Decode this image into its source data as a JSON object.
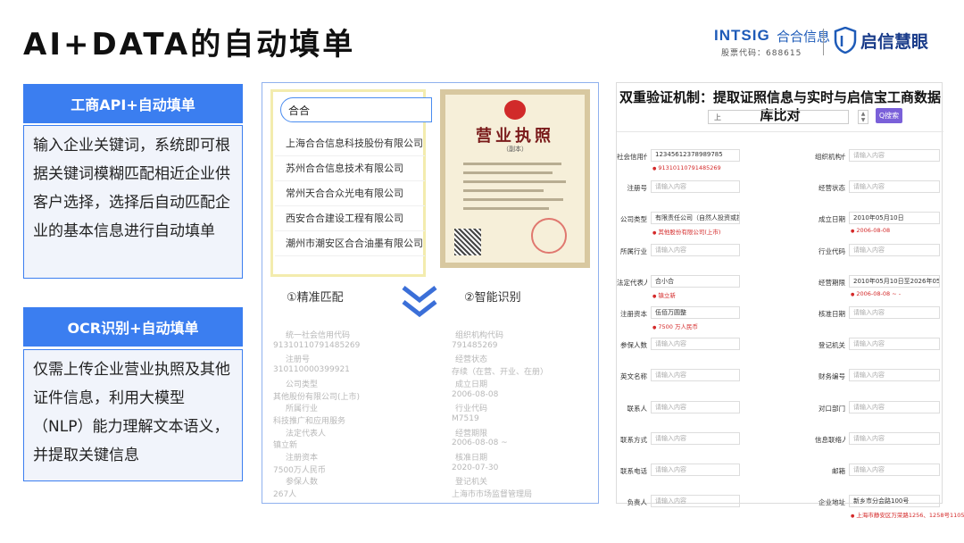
{
  "title": "AI+DATA的自动填单",
  "logo": {
    "intsig": "INTSIG",
    "intsig_cn": "合合信息",
    "stock_code": "股票代码：688615",
    "qixin": "启信慧眼",
    "qixin_icon": "qixin-shield-icon"
  },
  "section_api": {
    "header": "工商API+自动填单",
    "body": "输入企业关键词，系统即可根据关键词模糊匹配相近企业供客户选择，选择后自动匹配企业的基本信息进行自动填单"
  },
  "section_ocr": {
    "header": "OCR识别+自动填单",
    "body": "仅需上传企业营业执照及其他证件信息，利用大模型（NLP）能力理解文本语义，并提取关键信息"
  },
  "search": {
    "value": "合合",
    "suggestions": [
      "上海合合信息科技股份有限公司",
      "苏州合合信息技术有限公司",
      "常州天合合众光电有限公司",
      "西安合合建设工程有限公司",
      "潮州市潮安区合合油墨有限公司"
    ]
  },
  "license": {
    "title": "营业执照",
    "subtitle": "（副本）"
  },
  "steps": {
    "step1": "①精准匹配",
    "step2": "②智能识别"
  },
  "faded_form": [
    [
      "统一社会信用代码",
      "组织机构代码"
    ],
    [
      "91310110791485269",
      "791485269"
    ],
    [
      "注册号",
      "经营状态"
    ],
    [
      "310110000399921",
      "存续（在营、开业、在册）"
    ],
    [
      "公司类型",
      "成立日期"
    ],
    [
      "其他股份有限公司(上市)",
      "2006-08-08"
    ],
    [
      "所属行业",
      "行业代码"
    ],
    [
      "科技推广和应用服务",
      "M7519"
    ],
    [
      "法定代表人",
      "经营期限"
    ],
    [
      "镇立新",
      "2006-08-08 ~"
    ],
    [
      "注册资本",
      "核准日期"
    ],
    [
      "7500万人民币",
      "2020-07-30"
    ],
    [
      "参保人数",
      "登记机关"
    ],
    [
      "267人",
      "上海市市场监督管理局"
    ]
  ],
  "right_panel": {
    "title": "双重验证机制：提取证照信息与实时与启信宝工商数据库比对",
    "search_value": "上",
    "search_button": "Q搜索",
    "placeholder": "请输入内容",
    "fields_left": [
      {
        "label": "社会信用代码",
        "value": "12345612378989785",
        "hint": "91310110791485269"
      },
      {
        "label": "注册号",
        "value": "",
        "hint": ""
      },
      {
        "label": "公司类型",
        "value": "有限责任公司（自然人投资或控股）",
        "hint": "其他股份有限公司(上市)"
      },
      {
        "label": "所属行业",
        "value": "",
        "hint": ""
      },
      {
        "label": "法定代表人",
        "value": "合小合",
        "hint": "镇立新"
      },
      {
        "label": "注册资本",
        "value": "伍佰万圆整",
        "hint": "7500 万人民币"
      },
      {
        "label": "参保人数",
        "value": "",
        "hint": ""
      },
      {
        "label": "英文名称",
        "value": "",
        "hint": ""
      },
      {
        "label": "联系人",
        "value": "",
        "hint": ""
      },
      {
        "label": "联系方式",
        "value": "",
        "hint": ""
      },
      {
        "label": "联系电话",
        "value": "",
        "hint": ""
      },
      {
        "label": "负责人",
        "value": "",
        "hint": ""
      }
    ],
    "fields_right": [
      {
        "label": "组织机构代码",
        "value": "",
        "hint": ""
      },
      {
        "label": "经营状态",
        "value": "",
        "hint": ""
      },
      {
        "label": "成立日期",
        "value": "2010年05月10日",
        "hint": "2006-08-08"
      },
      {
        "label": "行业代码",
        "value": "",
        "hint": ""
      },
      {
        "label": "经营期限",
        "value": "2010年05月10日至2026年05月09日",
        "hint": "2006-08-08 ~ -"
      },
      {
        "label": "核准日期",
        "value": "",
        "hint": ""
      },
      {
        "label": "登记机关",
        "value": "",
        "hint": ""
      },
      {
        "label": "财务编号",
        "value": "",
        "hint": ""
      },
      {
        "label": "对口部门",
        "value": "",
        "hint": ""
      },
      {
        "label": "信息联络人",
        "value": "",
        "hint": ""
      },
      {
        "label": "邮箱",
        "value": "",
        "hint": ""
      },
      {
        "label": "企业地址",
        "value": "新乡市分会路100号",
        "hint": "上海市静安区万荣路1256、1258号1105-1121室"
      }
    ]
  }
}
